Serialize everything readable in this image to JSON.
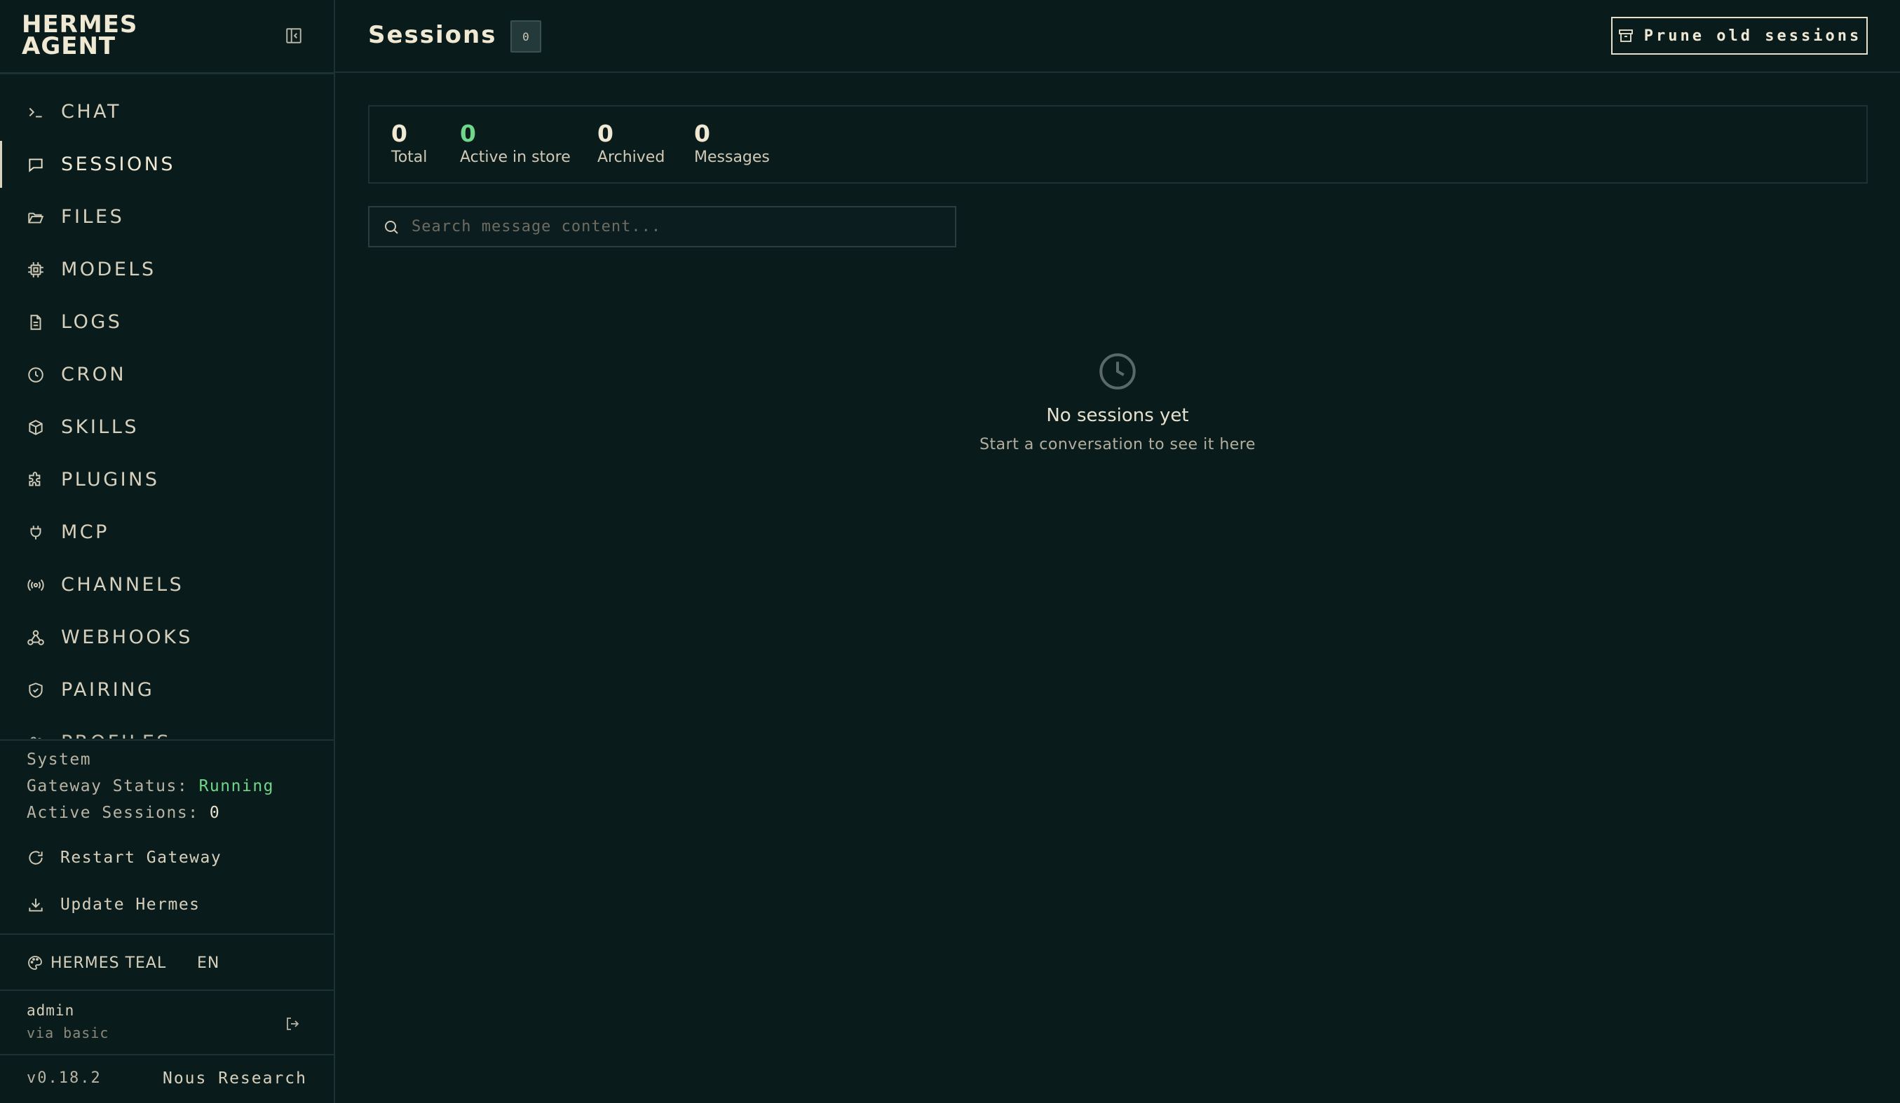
{
  "brand": {
    "line1": "HERMES",
    "line2": "AGENT"
  },
  "sidebar": {
    "items": [
      {
        "label": "CHAT",
        "icon": "terminal-icon"
      },
      {
        "label": "SESSIONS",
        "icon": "message-square-icon",
        "active": true
      },
      {
        "label": "FILES",
        "icon": "folder-open-icon"
      },
      {
        "label": "MODELS",
        "icon": "cpu-icon"
      },
      {
        "label": "LOGS",
        "icon": "file-text-icon"
      },
      {
        "label": "CRON",
        "icon": "clock-icon"
      },
      {
        "label": "SKILLS",
        "icon": "package-icon"
      },
      {
        "label": "PLUGINS",
        "icon": "puzzle-icon"
      },
      {
        "label": "MCP",
        "icon": "plug-icon"
      },
      {
        "label": "CHANNELS",
        "icon": "radio-icon"
      },
      {
        "label": "WEBHOOKS",
        "icon": "webhook-icon"
      },
      {
        "label": "PAIRING",
        "icon": "shield-check-icon"
      },
      {
        "label": "PROFILES",
        "icon": "users-icon"
      }
    ]
  },
  "system": {
    "heading": "System",
    "gateway_label": "Gateway Status:",
    "gateway_value": "Running",
    "sessions_label": "Active Sessions:",
    "sessions_value": "0",
    "restart_label": "Restart Gateway",
    "update_label": "Update Hermes"
  },
  "theme": {
    "label": "HERMES TEAL",
    "lang": "EN"
  },
  "user": {
    "name": "admin",
    "via": "via basic"
  },
  "footer": {
    "version": "v0.18.2",
    "org": "Nous Research"
  },
  "header": {
    "title": "Sessions",
    "count": "0",
    "prune_label": "Prune old sessions"
  },
  "stats": [
    {
      "value": "0",
      "label": "Total"
    },
    {
      "value": "0",
      "label": "Active in store",
      "accent": true
    },
    {
      "value": "0",
      "label": "Archived"
    },
    {
      "value": "0",
      "label": "Messages"
    }
  ],
  "search": {
    "placeholder": "Search message content...",
    "value": ""
  },
  "empty": {
    "title": "No sessions yet",
    "subtitle": "Start a conversation to see it here"
  },
  "colors": {
    "background": "#0a1b1c",
    "accent_green": "#6fd68a",
    "text": "#e6e0cc",
    "border": "#1f3233"
  }
}
